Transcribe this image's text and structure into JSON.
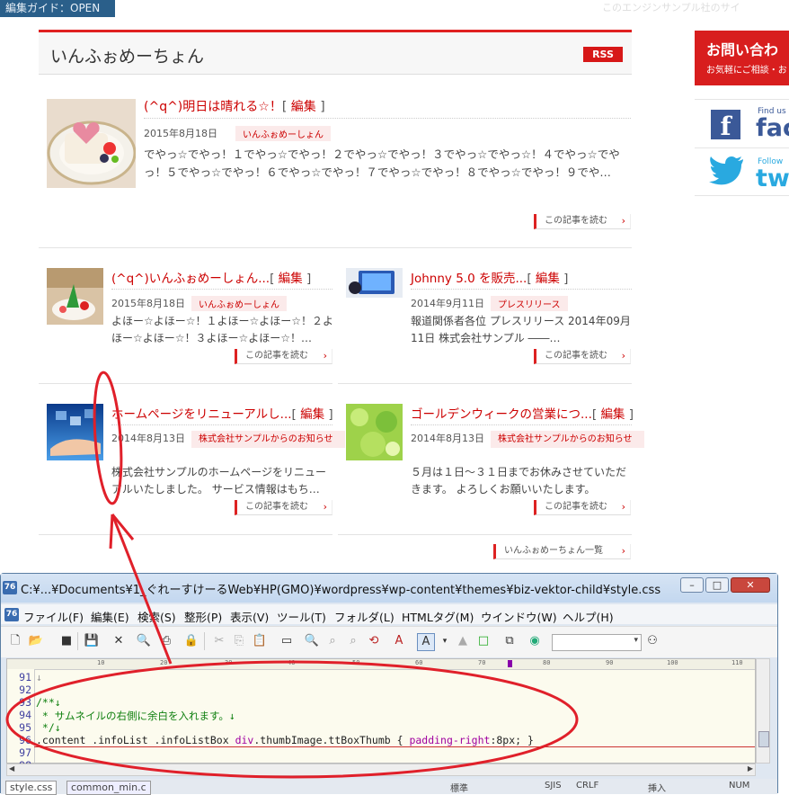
{
  "top": {
    "edit_guide": "編集ガイド：OPEN",
    "faded_text": "このエンジンサンプル社のサイ"
  },
  "info": {
    "title": "いんふぉめーちょん",
    "rss_label": "RSS",
    "more_label": "この記事を読む",
    "list_link": "いんふぉめーちょん一覧",
    "edit_label": "編集",
    "posts": [
      {
        "title": "(^q^)明日は晴れる☆！",
        "date": "2015年8月18日",
        "category": "いんふぉめーしょん",
        "excerpt": "でやっ☆でやっ！１でやっ☆でやっ！２でやっ☆でやっ！３でやっ☆でやっ☆！４でやっ☆でやっ！５でやっ☆でやっ！６でやっ☆でやっ！７でやっ☆でやっ！８でやっ☆でやっ！９でや…"
      },
      {
        "title": "(^q^)いんふぉめーしょん...",
        "date": "2015年8月18日",
        "category": "いんふぉめーしょん",
        "excerpt": "よほー☆よほー☆！１よほー☆よほー☆！２よほー☆よほー☆！３よほー☆よほー☆！…"
      },
      {
        "title": "Johnny 5.0 を販売...",
        "date": "2014年9月11日",
        "category": "プレスリリース",
        "excerpt": "報道関係者各位 プレスリリース 2014年09月11日 株式会社サンプル ――…"
      },
      {
        "title": "ホームページをリニューアルし...",
        "date": "2014年8月13日",
        "category": "株式会社サンプルからのお知らせ",
        "excerpt": "株式会社サンプルのホームページをリニューアルいたしました。 サービス情報はもち…"
      },
      {
        "title": "ゴールデンウィークの営業につ...",
        "date": "2014年8月13日",
        "category": "株式会社サンプルからのお知らせ",
        "excerpt": "５月は１日～３１日までお休みさせていただきます。 よろしくお願いいたします。"
      }
    ]
  },
  "sidebar": {
    "contact_title": "お問い合わ",
    "contact_sub": "お気軽にご相談・お",
    "fb_small": "Find us o",
    "fb_big": "fac",
    "tw_small": "Follow",
    "tw_big": "tw"
  },
  "editor": {
    "window_title": "C:¥...¥Documents¥1_ぐれーすけーるWeb¥HP(GMO)¥wordpress¥wp-content¥themes¥biz-vektor-child¥style.css",
    "app_icon": "76",
    "menu": [
      "ファイル(F)",
      "編集(E)",
      "検索(S)",
      "整形(P)",
      "表示(V)",
      "ツール(T)",
      "フォルダ(L)",
      "HTMLタグ(M)",
      "ウインドウ(W)",
      "ヘルプ(H)"
    ],
    "ruler": [
      "10",
      "20",
      "30",
      "40",
      "50",
      "60",
      "70",
      "80",
      "90",
      "100",
      "110"
    ],
    "lines": [
      {
        "num": "91",
        "text": "↓"
      },
      {
        "num": "92",
        "text": ""
      },
      {
        "num": "93",
        "text": "/**↓"
      },
      {
        "num": "94",
        "text": " * サムネイルの右側に余白を入れます。↓"
      },
      {
        "num": "95",
        "text": " */↓"
      },
      {
        "num": "96",
        "sel": ".content .infoList .infoListBox ",
        "kw": "div",
        "rest": ".thumbImage.ttBoxThumb { ",
        "prop": "padding-right",
        "val": ":8px; }"
      },
      {
        "num": "97",
        "text": ""
      },
      {
        "num": "98",
        "text": ""
      }
    ],
    "tabs": [
      "style.css",
      "common_min.c"
    ],
    "status": [
      "標準",
      "SJIS",
      "CRLF",
      "挿入",
      "NUM"
    ]
  },
  "colors": {
    "accent": "#d71818",
    "editor_bg": "#fcfbee",
    "link": "#cc0000"
  }
}
